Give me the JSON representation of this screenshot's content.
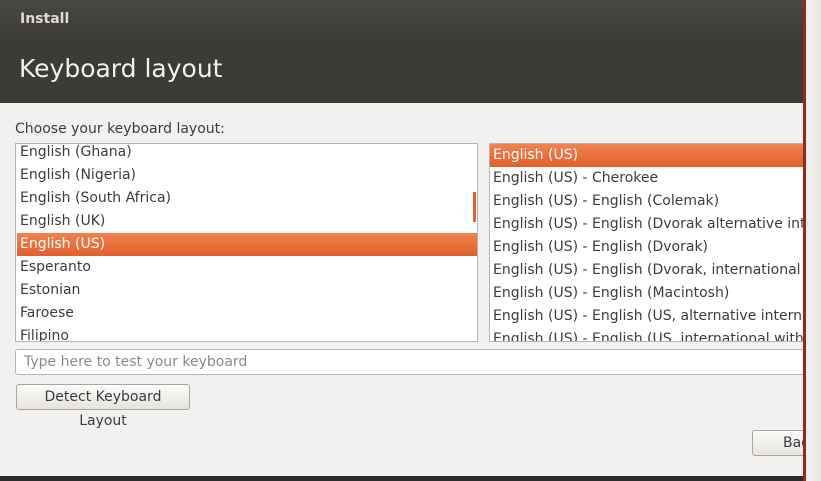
{
  "window": {
    "title": "Install",
    "heading": "Keyboard layout"
  },
  "prompt": "Choose your keyboard layout:",
  "layouts": [
    {
      "label": "English (Ghana)",
      "selected": false
    },
    {
      "label": "English (Nigeria)",
      "selected": false
    },
    {
      "label": "English (South Africa)",
      "selected": false
    },
    {
      "label": "English (UK)",
      "selected": false
    },
    {
      "label": "English (US)",
      "selected": true
    },
    {
      "label": "Esperanto",
      "selected": false
    },
    {
      "label": "Estonian",
      "selected": false
    },
    {
      "label": "Faroese",
      "selected": false
    },
    {
      "label": "Filipino",
      "selected": false
    }
  ],
  "variants": [
    {
      "label": "English (US)",
      "selected": true
    },
    {
      "label": "English (US) - Cherokee",
      "selected": false
    },
    {
      "label": "English (US) - English (Colemak)",
      "selected": false
    },
    {
      "label": "English (US) - English (Dvorak alternative intern",
      "selected": false
    },
    {
      "label": "English (US) - English (Dvorak)",
      "selected": false
    },
    {
      "label": "English (US) - English (Dvorak, international wit",
      "selected": false
    },
    {
      "label": "English (US) - English (Macintosh)",
      "selected": false
    },
    {
      "label": "English (US) - English (US, alternative internatio",
      "selected": false
    },
    {
      "label": "English (US) - English (US, international with de",
      "selected": false
    }
  ],
  "test_input": {
    "placeholder": "Type here to test your keyboard",
    "value": ""
  },
  "buttons": {
    "detect": "Detect Keyboard Layout",
    "back": "Back"
  },
  "colors": {
    "selection": "#e9692f",
    "header_bg": "#3c3b37",
    "window_bg": "#f2f1f0"
  }
}
